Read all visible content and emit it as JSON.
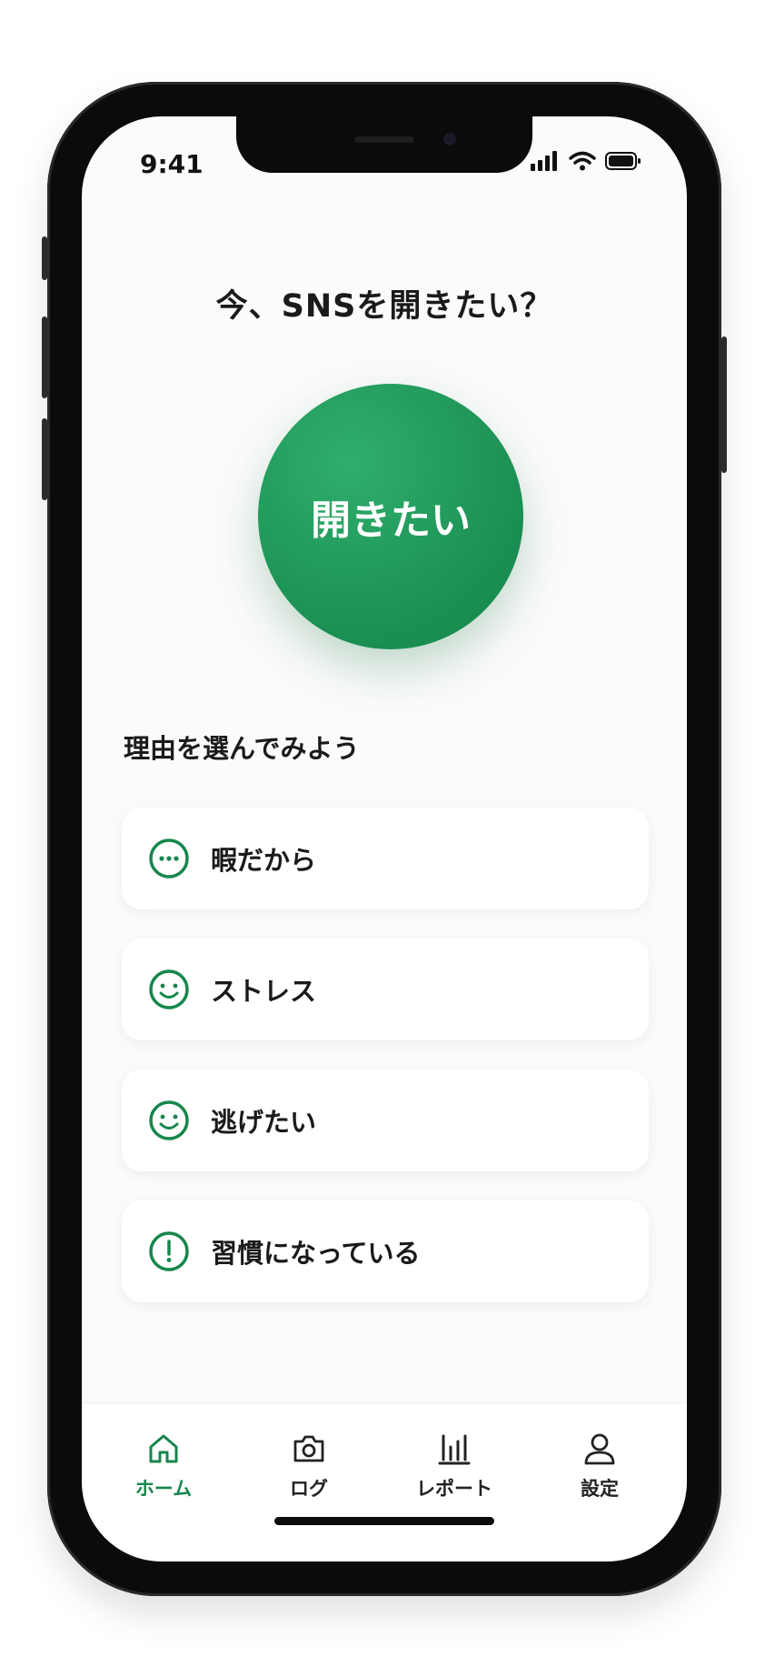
{
  "status": {
    "time": "9:41"
  },
  "screen": {
    "title": "今、SNSを開きたい？",
    "main_button": "開きたい",
    "prompt": "理由を選んでみよう"
  },
  "reasons": [
    {
      "label": "暇だから",
      "icon": "dots-circle-icon"
    },
    {
      "label": "ストレス",
      "icon": "smile-icon"
    },
    {
      "label": "逃げたい",
      "icon": "smile-icon"
    },
    {
      "label": "習慣になっている",
      "icon": "exclamation-circle-icon"
    }
  ],
  "tabs": [
    {
      "label": "ホーム",
      "icon": "home-icon",
      "active": true
    },
    {
      "label": "ログ",
      "icon": "camera-icon",
      "active": false
    },
    {
      "label": "レポート",
      "icon": "chart-icon",
      "active": false
    },
    {
      "label": "設定",
      "icon": "user-icon",
      "active": false
    }
  ],
  "colors": {
    "accent": "#17864c",
    "text": "#1a1a1a",
    "inactive": "#222222"
  }
}
